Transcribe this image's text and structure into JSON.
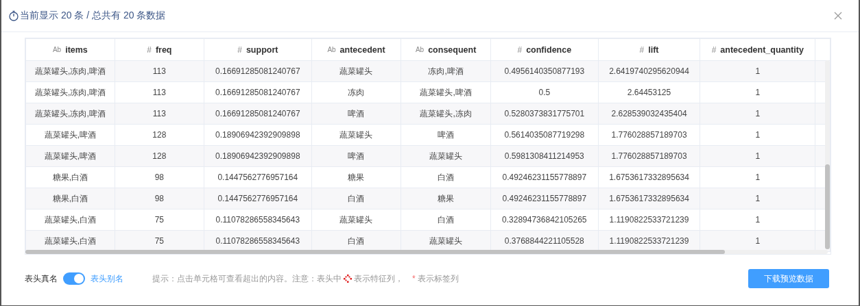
{
  "dialog": {
    "title": "当前显示 20 条 / 总共有 20 条数据"
  },
  "table": {
    "columns": [
      {
        "label": "items",
        "type_icon": "Ab"
      },
      {
        "label": "freq",
        "type_icon": "#"
      },
      {
        "label": "support",
        "type_icon": "#"
      },
      {
        "label": "antecedent",
        "type_icon": "Ab"
      },
      {
        "label": "consequent",
        "type_icon": "Ab"
      },
      {
        "label": "confidence",
        "type_icon": "#"
      },
      {
        "label": "lift",
        "type_icon": "#"
      },
      {
        "label": "antecedent_quantity",
        "type_icon": "#"
      }
    ],
    "rows": [
      [
        "蔬菜罐头,冻肉,啤酒",
        "113",
        "0.16691285081240767",
        "蔬菜罐头",
        "冻肉,啤酒",
        "0.4956140350877193",
        "2.6419740295620944",
        "1"
      ],
      [
        "蔬菜罐头,冻肉,啤酒",
        "113",
        "0.16691285081240767",
        "冻肉",
        "蔬菜罐头,啤酒",
        "0.5",
        "2.64453125",
        "1"
      ],
      [
        "蔬菜罐头,冻肉,啤酒",
        "113",
        "0.16691285081240767",
        "啤酒",
        "蔬菜罐头,冻肉",
        "0.5280373831775701",
        "2.628539032435404",
        "1"
      ],
      [
        "蔬菜罐头,啤酒",
        "128",
        "0.18906942392909898",
        "蔬菜罐头",
        "啤酒",
        "0.5614035087719298",
        "1.776028857189703",
        "1"
      ],
      [
        "蔬菜罐头,啤酒",
        "128",
        "0.18906942392909898",
        "啤酒",
        "蔬菜罐头",
        "0.5981308411214953",
        "1.776028857189703",
        "1"
      ],
      [
        "糖果,白酒",
        "98",
        "0.1447562776957164",
        "糖果",
        "白酒",
        "0.49246231155778897",
        "1.6753617332895634",
        "1"
      ],
      [
        "糖果,白酒",
        "98",
        "0.1447562776957164",
        "白酒",
        "糖果",
        "0.49246231155778897",
        "1.6753617332895634",
        "1"
      ],
      [
        "蔬菜罐头,白酒",
        "75",
        "0.11078286558345643",
        "蔬菜罐头",
        "白酒",
        "0.32894736842105265",
        "1.1190822533721239",
        "1"
      ],
      [
        "蔬菜罐头,白酒",
        "75",
        "0.11078286558345643",
        "白酒",
        "蔬菜罐头",
        "0.3768844221105528",
        "1.1190822533721239",
        "1"
      ]
    ]
  },
  "footer": {
    "toggle": {
      "left_label": "表头真名",
      "right_label": "表头别名",
      "on": true
    },
    "hint_before": "提示：点击单元格可查看超出的内容。注意：表头中",
    "hint_feature": "表示特征列，",
    "label_mark": "*",
    "hint_label": "表示标签列",
    "download_button": "下载预览数据"
  }
}
